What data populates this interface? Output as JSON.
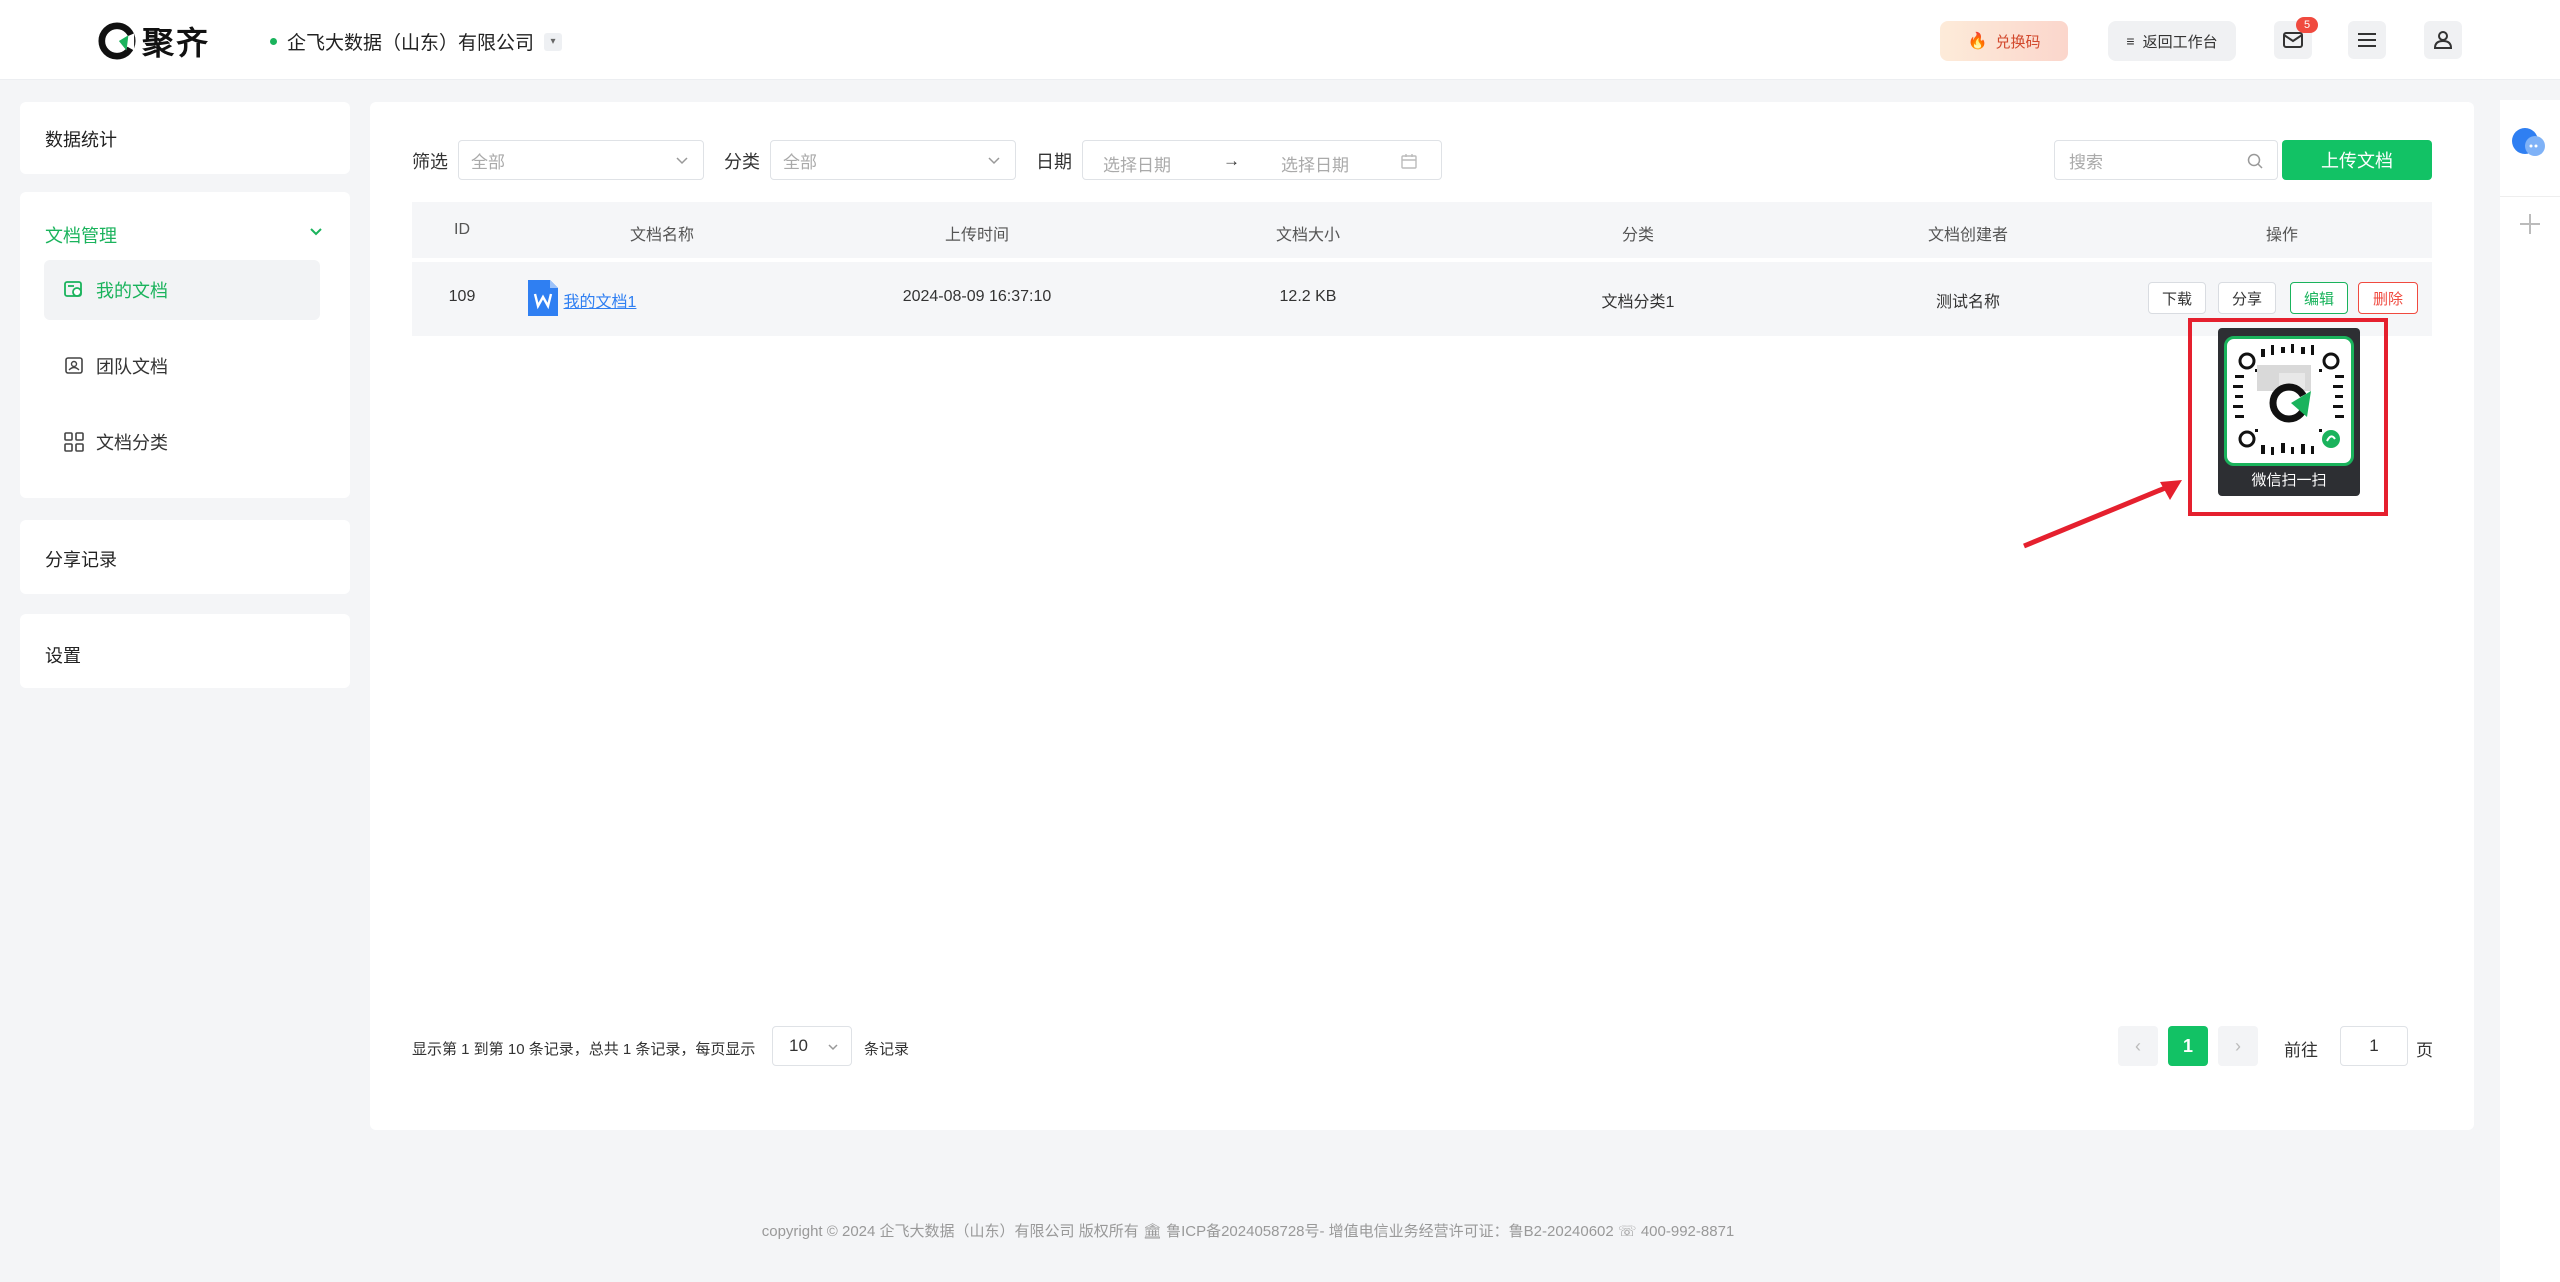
{
  "header": {
    "logo_text": "聚齐",
    "company": "企飞大数据（山东）有限公司",
    "redeem_label": "兑换码",
    "back_workspace_label": "返回工作台",
    "mail_badge": "5"
  },
  "sidebar": {
    "stats": "数据统计",
    "doc_management": "文档管理",
    "items": [
      {
        "label": "我的文档"
      },
      {
        "label": "团队文档"
      },
      {
        "label": "文档分类"
      }
    ],
    "share_records": "分享记录",
    "settings": "设置"
  },
  "filters": {
    "filter_label": "筛选",
    "filter_value": "全部",
    "category_label": "分类",
    "category_value": "全部",
    "date_label": "日期",
    "date_start_placeholder": "选择日期",
    "date_arrow": "→",
    "date_end_placeholder": "选择日期",
    "search_placeholder": "搜索",
    "upload_label": "上传文档"
  },
  "table": {
    "headers": [
      "ID",
      "文档名称",
      "上传时间",
      "文档大小",
      "分类",
      "文档创建者",
      "操作"
    ],
    "rows": [
      {
        "id": "109",
        "name": "我的文档1",
        "uploaded": "2024-08-09 16:37:10",
        "size": "12.2 KB",
        "category": "文档分类1",
        "creator": "测试名称",
        "actions": [
          "下载",
          "分享",
          "编辑",
          "删除"
        ]
      }
    ]
  },
  "qr_popup": {
    "caption": "微信扫一扫"
  },
  "pagination": {
    "summary": "显示第 1 到第 10 条记录，总共 1 条记录，每页显示",
    "page_size": "10",
    "records_suffix": "条记录",
    "current_page": "1",
    "goto_label": "前往",
    "goto_value": "1",
    "page_suffix": "页"
  },
  "footer": {
    "text": "copyright © 2024 企飞大数据（山东）有限公司 版权所有  🏛 鲁ICP备2024058728号-  增值电信业务经营许可证：鲁B2-20240602 ☏ 400-992-8871"
  },
  "colors": {
    "brand_green": "#12c265",
    "accent_red": "#e5202e",
    "link_blue": "#2f7ff2"
  }
}
